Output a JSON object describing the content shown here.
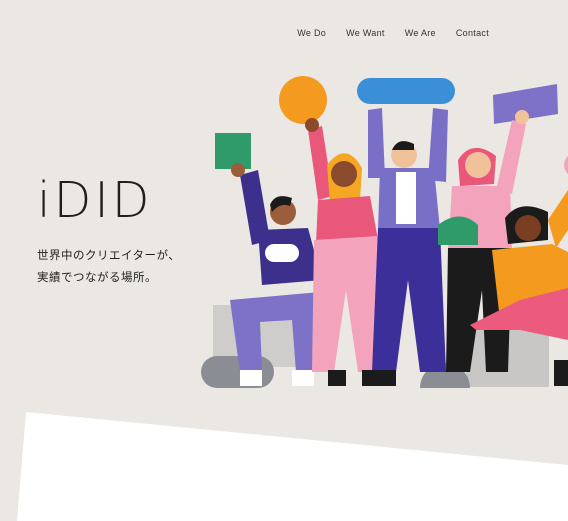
{
  "nav": {
    "items": [
      {
        "label": "We Do"
      },
      {
        "label": "We Want"
      },
      {
        "label": "We Are"
      },
      {
        "label": "Contact"
      }
    ]
  },
  "hero": {
    "logo": "iDID",
    "tagline_line1": "世界中のクリエイターが、",
    "tagline_line2": "実績でつながる場所。"
  },
  "colors": {
    "background": "#ebe8e3",
    "accent_orange": "#f39a1f",
    "accent_blue": "#3b8fd9",
    "accent_purple": "#7d71c8",
    "accent_green": "#2f9b6b",
    "accent_pink": "#ef6a8a"
  }
}
